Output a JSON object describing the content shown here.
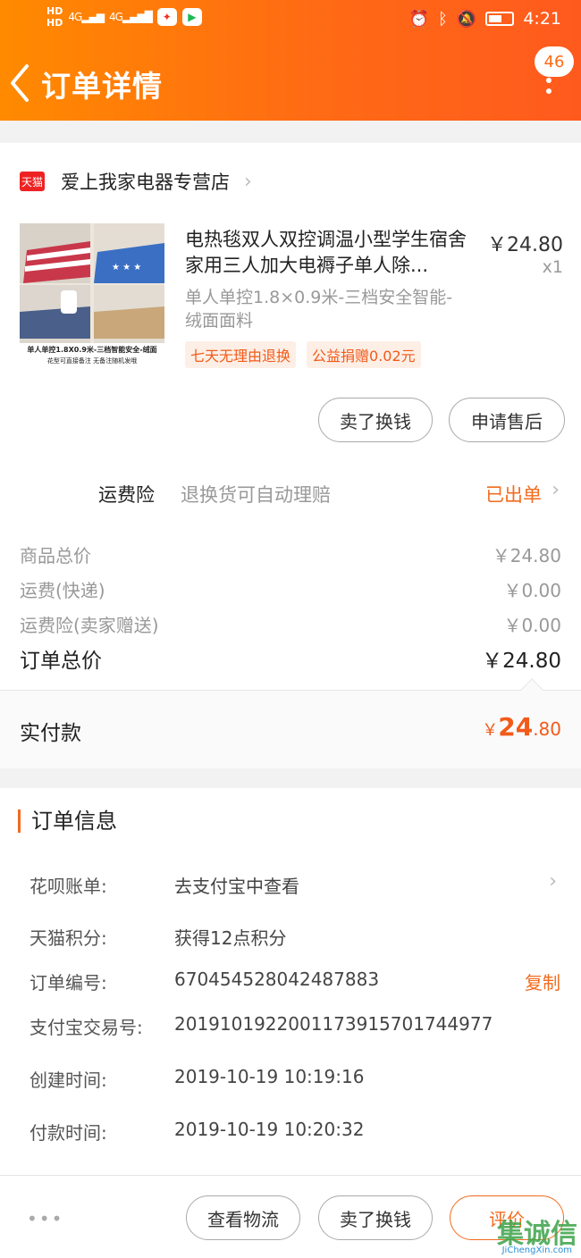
{
  "status_bar": {
    "hd1": "HD",
    "hd2": "HD",
    "sig1": "4G",
    "sig2": "4G",
    "time": "4:21",
    "icons": [
      "alarm-icon",
      "bluetooth-icon",
      "mute-icon",
      "battery-icon"
    ]
  },
  "header": {
    "title": "订单详情",
    "badge": "46"
  },
  "shop": {
    "logo_text": "天猫",
    "name": "爱上我家电器专营店"
  },
  "product": {
    "title": "电热毯双人双控调温小型学生宿舍家用三人加大电褥子单人除...",
    "price": "￥24.80",
    "qty": "x1",
    "sku": "单人单控1.8×0.9米-三档安全智能-绒面面料",
    "tags": [
      "七天无理由退换",
      "公益捐赠0.02元"
    ],
    "image_caption": "单人单控1.8X0.9米-三档智能安全-绒面",
    "image_subcaption": "花型可直接备注 无备注随机发哦"
  },
  "actions": {
    "sell": "卖了换钱",
    "after_sale": "申请售后"
  },
  "insurance": {
    "label": "运费险",
    "desc": "退换货可自动理赔",
    "status": "已出单"
  },
  "summary": {
    "goods_label": "商品总价",
    "goods_val": "￥24.80",
    "ship_label": "运费(快递)",
    "ship_val": "￥0.00",
    "ins_label": "运费险(卖家赠送)",
    "ins_val": "￥0.00",
    "total_label": "订单总价",
    "total_val": "￥24.80"
  },
  "payment": {
    "label": "实付款",
    "currency": "￥",
    "int": "24",
    "dec": ".80"
  },
  "order_info": {
    "title": "订单信息",
    "rows": [
      {
        "key": "花呗账单:",
        "val": "去支付宝中查看"
      },
      {
        "key": "天猫积分:",
        "val": "获得12点积分"
      },
      {
        "key": "订单编号:",
        "val": "670454528042487883",
        "action": "复制"
      },
      {
        "key": "支付宝交易号:",
        "val": "2019101922001173915701744977"
      },
      {
        "key": "创建时间:",
        "val": "2019-10-19 10:19:16"
      },
      {
        "key": "付款时间:",
        "val": "2019-10-19 10:20:32"
      }
    ]
  },
  "bottom": {
    "logistics": "查看物流",
    "sell": "卖了换钱",
    "review": "评价"
  },
  "watermark": {
    "text": "集诚信",
    "url": "JiChengXin.com"
  }
}
